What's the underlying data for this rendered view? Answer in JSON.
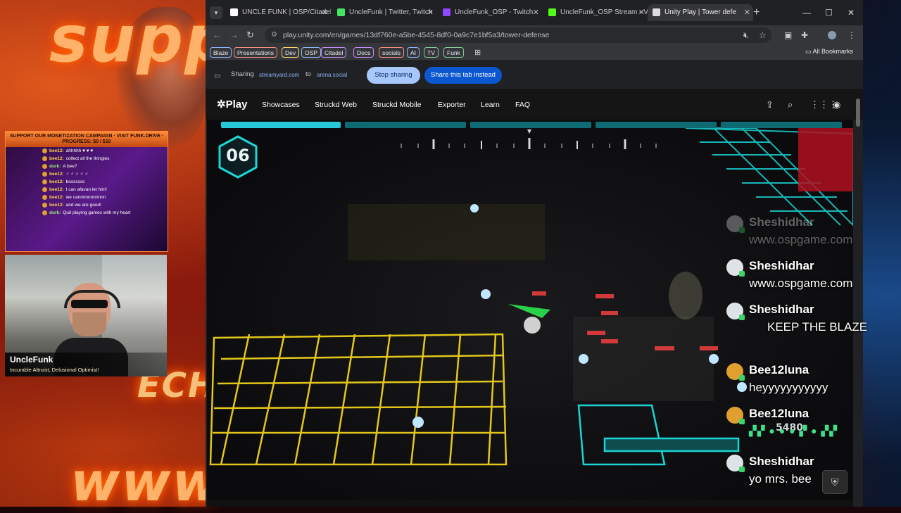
{
  "stream": {
    "bg_words": [
      "supp",
      "ECHO",
      "www"
    ],
    "overlay_banner": "SUPPORT OUR MONETIZATION CAMPAIGN · VISIT FUNK.DRIVE · PROGRESS: $0 / $10",
    "chat": [
      {
        "user": "bee12:",
        "text": "ahhhhh ♥ ♥ ♥"
      },
      {
        "user": "bee12:",
        "text": "collect all the thingies"
      },
      {
        "user": "durk:",
        "text": "A bee?"
      },
      {
        "user": "bee12:",
        "text": "♂ ♂ ♂ ♂ ♂"
      },
      {
        "user": "bee12:",
        "text": "bossssss"
      },
      {
        "user": "bee12:",
        "text": "I can afavan let him!"
      },
      {
        "user": "bee12:",
        "text": "we cannnnnnnnnnn"
      },
      {
        "user": "bee12:",
        "text": "and we are good!"
      },
      {
        "user": "durk:",
        "text": "Quit playing games with my heart"
      }
    ],
    "streamer_name": "UncleFunk",
    "streamer_tagline": "Incurable Altruist, Delusional Optimist!"
  },
  "browser": {
    "tabs": [
      {
        "label": "UNCLE FUNK | OSP/Citadel (C",
        "icon": "x-logo-icon",
        "color": "#ffffff"
      },
      {
        "label": "UncleFunk | Twitter, Twitch",
        "icon": "linktree-icon",
        "color": "#43e660"
      },
      {
        "label": "UncleFunk_OSP - Twitch",
        "icon": "twitch-icon",
        "color": "#9146ff"
      },
      {
        "label": "UncleFunk_OSP Stream - V",
        "icon": "kick-icon",
        "color": "#53fc18"
      },
      {
        "label": "Unity Play | Tower defe",
        "icon": "unity-icon",
        "color": "#dddddd"
      }
    ],
    "url": "play.unity.com/en/games/13df760e-a5be-4545-8df0-0a9c7e1bf5a3/tower-defense",
    "bookmarks": [
      {
        "label": "Blaze",
        "color": "#8ab4f8"
      },
      {
        "label": "Presentations",
        "color": "#f28b82"
      },
      {
        "label": "Dev",
        "color": "#fdd663"
      },
      {
        "label": "OSP",
        "color": "#8ab4f8"
      },
      {
        "label": "Citadel",
        "color": "#c58af9"
      },
      {
        "label": "Docs",
        "color": "#c58af9"
      },
      {
        "label": "socials",
        "color": "#f28b82"
      },
      {
        "label": "AI",
        "color": "#8ab4f8"
      },
      {
        "label": "TV",
        "color": "#81c995"
      },
      {
        "label": "Funk",
        "color": "#81c995"
      }
    ],
    "all_bookmarks": "All Bookmarks",
    "share": {
      "sharing_label": "Sharing",
      "from": "streamyard.com",
      "to_label": "to",
      "to": "arena.social",
      "stop": "Stop sharing",
      "switch": "Share this tab instead"
    }
  },
  "site": {
    "brand": "Play",
    "nav": [
      "Showcases",
      "Struckd Web",
      "Struckd Mobile",
      "Exporter",
      "Learn",
      "FAQ"
    ]
  },
  "game": {
    "wave": "06",
    "wave_progress": 1.0,
    "score": "5480",
    "ruler_labels": [
      "",
      "N",
      "",
      "NE",
      "",
      "E",
      "",
      "W"
    ],
    "accent": "#1ed6d6"
  },
  "overlay_chat": [
    {
      "user": "Sheshidhar",
      "text": "www.ospgame.com",
      "avatar": "#dfe3e8",
      "faded": true
    },
    {
      "user": "Sheshidhar",
      "text": "www.ospgame.com",
      "avatar": "#dfe3e8",
      "faded": false
    },
    {
      "user": "Sheshidhar",
      "text": "KEEP THE BLAZE",
      "avatar": "#dfe3e8",
      "faded": false
    },
    {
      "user": "Bee12luna",
      "text": "heyyyyyyyyyyy",
      "avatar": "#e0a030",
      "faded": false
    },
    {
      "user": "Bee12luna",
      "text": "",
      "avatar": "#e0a030",
      "faded": false
    },
    {
      "user": "Sheshidhar",
      "text": "yo mrs. bee",
      "avatar": "#dfe3e8",
      "faded": false
    }
  ]
}
